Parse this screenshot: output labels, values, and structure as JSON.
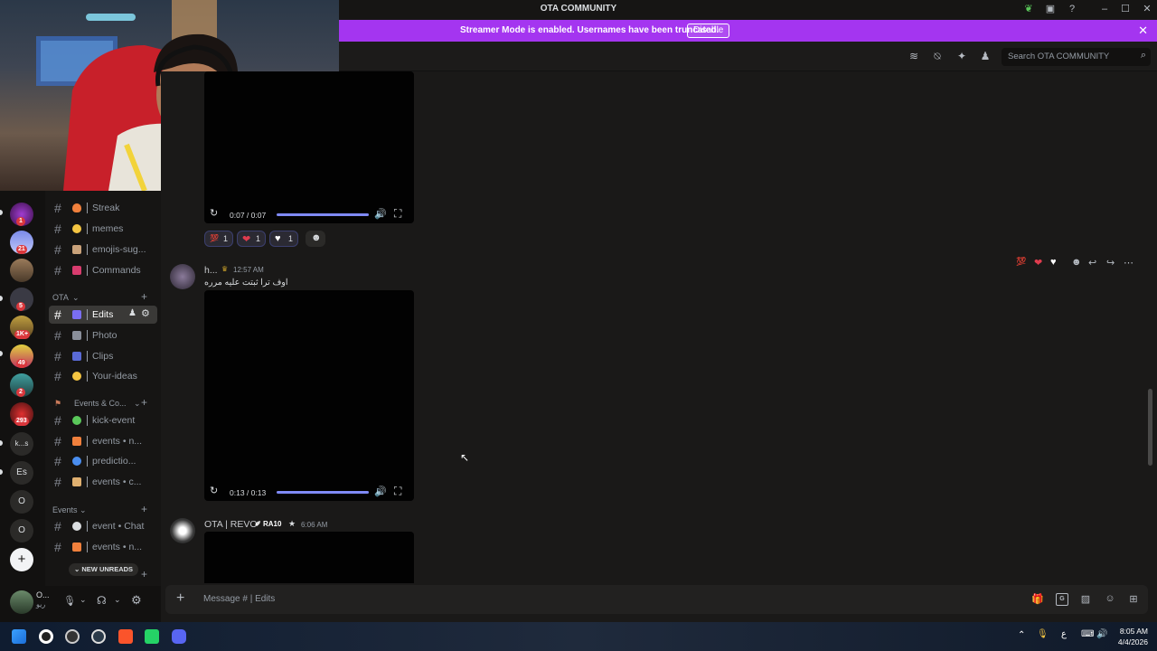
{
  "window": {
    "title": "OTA COMMUNITY",
    "minimize": "–",
    "maximize": "☐",
    "close": "✕"
  },
  "banner": {
    "text": "Streamer Mode is enabled. Usernames have been truncated.",
    "button": "Disable",
    "close": "✕"
  },
  "header": {
    "search_placeholder": "Search OTA COMMUNITY"
  },
  "servers": [
    {
      "badge": "1"
    },
    {
      "badge": "21"
    },
    {
      "badge": ""
    },
    {
      "badge": "5"
    },
    {
      "badge": "1K+"
    },
    {
      "badge": "49"
    },
    {
      "badge": "2"
    },
    {
      "badge": "293"
    }
  ],
  "server_text": {
    "ks": "k...s",
    "es": "Es",
    "o1": "O",
    "o2": "O",
    "add": "+"
  },
  "channels": {
    "top": [
      {
        "label": "Streak",
        "color": "#f0803c"
      },
      {
        "label": "memes",
        "color": "#f5c542"
      },
      {
        "label": "emojis-sug...",
        "color": "#c9a27a"
      },
      {
        "label": "Commands",
        "color": "#d83c6e"
      }
    ],
    "cat_ota": "OTA",
    "ota": [
      {
        "label": "Edits",
        "color": "#7a6ef2"
      },
      {
        "label": "Photo",
        "color": "#8a8f9a"
      },
      {
        "label": "Clips",
        "color": "#5a6ad6"
      },
      {
        "label": "Your-ideas",
        "color": "#f5c542"
      }
    ],
    "cat_events": "Events & Co...",
    "events": [
      {
        "label": "kick-event",
        "color": "#5ac85a"
      },
      {
        "label": "events • n...",
        "color": "#f0803c"
      },
      {
        "label": "predictio...",
        "color": "#4a8ef0"
      },
      {
        "label": "events • c...",
        "color": "#e0b070"
      }
    ],
    "cat_events2": "Events",
    "events2": [
      {
        "label": "event • Chat",
        "color": "#dbdee1"
      },
      {
        "label": "events • n...",
        "color": "#f0803c"
      }
    ],
    "new_unreads": "NEW UNREADS"
  },
  "user": {
    "name": "O...",
    "status": "ريو"
  },
  "video1": {
    "time": "0:07 / 0:07"
  },
  "reactions1": [
    {
      "glyph": "💯",
      "count": "1",
      "color": "#e03c6e"
    },
    {
      "glyph": "❤",
      "count": "1",
      "color": "#e03c4e"
    },
    {
      "glyph": "🤍",
      "count": "1",
      "color": "#ffffff"
    }
  ],
  "message2": {
    "author": "h...",
    "time": "12:57 AM",
    "text": "اوف ترا ثبتت عليه مرره"
  },
  "video2": {
    "time": "0:13 / 0:13"
  },
  "message3": {
    "author": "OTA | REVO",
    "tag": "RA10",
    "time": "6:06 AM"
  },
  "composer": {
    "placeholder": "Message #  | Edits"
  },
  "clock": {
    "time": "8:05 AM",
    "date": "4/4/2026"
  },
  "taskbar": {
    "lang": "ع"
  }
}
